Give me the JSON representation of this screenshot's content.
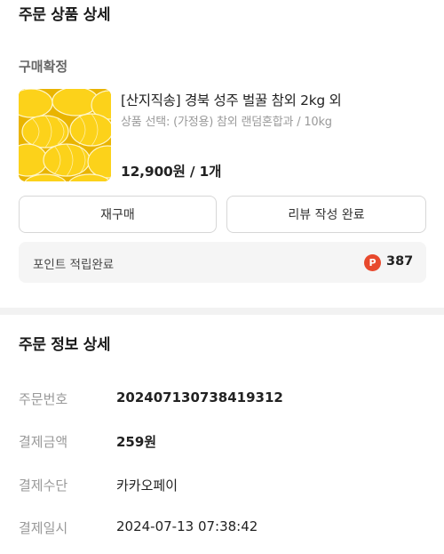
{
  "order_section": {
    "title": "주문 상품 상세"
  },
  "status": "구매확정",
  "product": {
    "name": "[산지직송] 경북 성주 벌꿀 참외 2kg 외",
    "option": "상품 선택: (가정용) 참외 랜덤혼합과 / 10kg",
    "price": "12,900원 / 1개",
    "image_icon": "korean-melon-image"
  },
  "buttons": {
    "rebuy": "재구매",
    "review": "리뷰 작성 완료"
  },
  "points": {
    "label": "포인트 적립완료",
    "icon_letter": "P",
    "value": "387",
    "icon_color": "#e8492d"
  },
  "info_section": {
    "title": "주문 정보 상세"
  },
  "info_rows": [
    {
      "label": "주문번호",
      "value": "20240713073841931​2"
    },
    {
      "label": "결제금액",
      "value": "259원"
    },
    {
      "label": "결제수단",
      "value": "카카오페이"
    },
    {
      "label": "결제일시",
      "value": "2024-07-13 07:38:42"
    }
  ]
}
